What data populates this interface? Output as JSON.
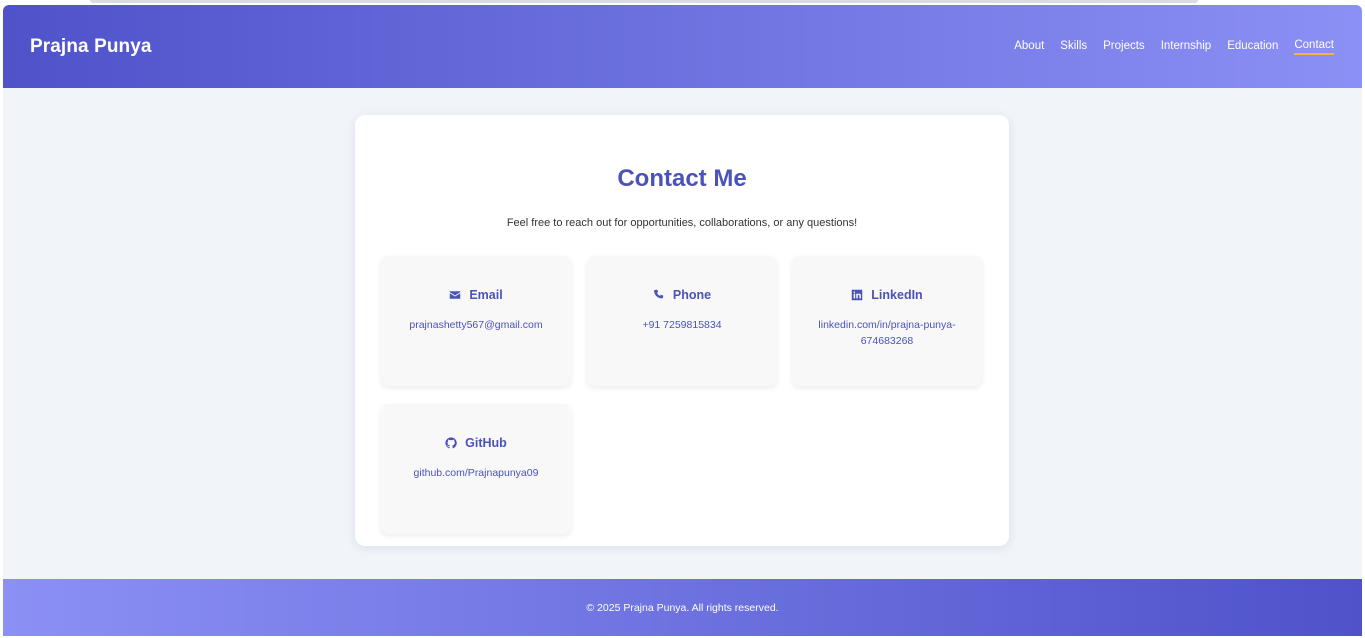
{
  "header": {
    "brand": "Prajna Punya",
    "nav": [
      {
        "label": "About"
      },
      {
        "label": "Skills"
      },
      {
        "label": "Projects"
      },
      {
        "label": "Internship"
      },
      {
        "label": "Education"
      },
      {
        "label": "Contact"
      }
    ],
    "active_nav": "Contact"
  },
  "contact": {
    "title": "Contact Me",
    "subtitle": "Feel free to reach out for opportunities, collaborations, or any questions!",
    "items": [
      {
        "icon": "envelope-icon",
        "label": "Email",
        "value": "prajnashetty567@gmail.com"
      },
      {
        "icon": "phone-icon",
        "label": "Phone",
        "value": "+91 7259815834"
      },
      {
        "icon": "linkedin-icon",
        "label": "LinkedIn",
        "value": "linkedin.com/in/prajna-punya-674683268"
      },
      {
        "icon": "github-icon",
        "label": "GitHub",
        "value": "github.com/Prajnapunya09"
      }
    ]
  },
  "footer": {
    "copyright": "© 2025 Prajna Punya. All rights reserved."
  },
  "colors": {
    "accent": "#4a53b8",
    "header_gradient_start": "#4f52c9",
    "header_gradient_end": "#8b90f5",
    "active_underline": "#f5b341",
    "page_background": "#f1f5f9"
  }
}
